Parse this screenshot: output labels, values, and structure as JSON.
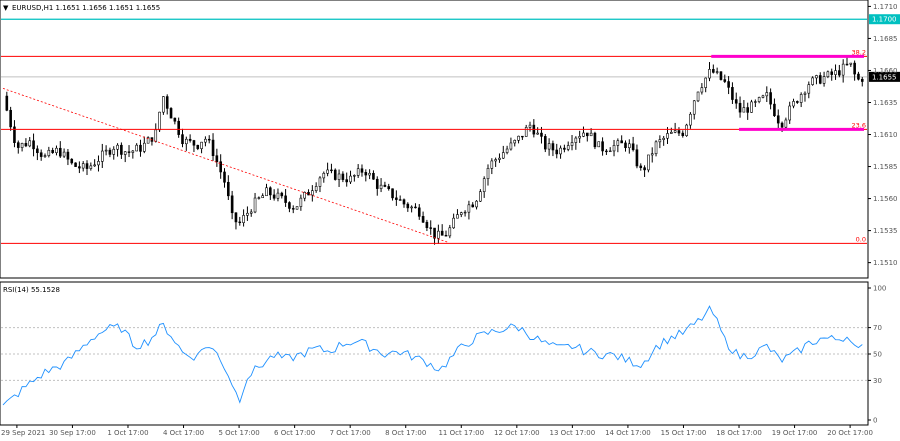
{
  "symbol_header": {
    "arrow": "▼",
    "text": "EURUSD,H1  1.1651 1.1656 1.1651 1.1655"
  },
  "indicator_header": "RSI(14) 55.1528",
  "colors": {
    "background": "#ffffff",
    "frame": "#000000",
    "candle": "#000000",
    "fib_line": "#ff0000",
    "resistance_line": "#00c0c0",
    "magenta_marker": "#ff00cc",
    "trendline": "#ff0000",
    "rsi_line": "#1e90ff",
    "rsi_level": "#c0c0c0",
    "bid_line": "#c0c0c0",
    "price_label_bg": "#000000",
    "price_label_text": "#ffffff"
  },
  "chart_data": [
    {
      "type": "candlestick",
      "symbol": "EURUSD",
      "timeframe": "H1",
      "ohlc_last": {
        "open": 1.1651,
        "high": 1.1656,
        "low": 1.1651,
        "close": 1.1655
      },
      "current_price": 1.1655,
      "ylim": [
        1.1498,
        1.1715
      ],
      "y_ticks": [
        "1.1710",
        "1.1685",
        "1.1660",
        "1.1635",
        "1.1610",
        "1.1585",
        "1.1560",
        "1.1535",
        "1.1510"
      ],
      "x_ticks": [
        "29 Sep 2021",
        "30 Sep 17:00",
        "1 Oct 17:00",
        "4 Oct 17:00",
        "5 Oct 17:00",
        "6 Oct 17:00",
        "7 Oct 17:00",
        "8 Oct 17:00",
        "11 Oct 17:00",
        "12 Oct 17:00",
        "13 Oct 17:00",
        "14 Oct 17:00",
        "15 Oct 17:00",
        "18 Oct 17:00",
        "19 Oct 17:00",
        "20 Oct 17:00"
      ],
      "close_path": [
        [
          0,
          1.164
        ],
        [
          2,
          1.16
        ],
        [
          4,
          1.1605
        ],
        [
          6,
          1.1592
        ],
        [
          8,
          1.1598
        ],
        [
          10,
          1.1586
        ],
        [
          12,
          1.1583
        ],
        [
          14,
          1.1592
        ],
        [
          16,
          1.1601
        ],
        [
          18,
          1.1596
        ],
        [
          20,
          1.16
        ],
        [
          22,
          1.1611
        ],
        [
          23,
          1.1641
        ],
        [
          24,
          1.1628
        ],
        [
          26,
          1.1605
        ],
        [
          28,
          1.1602
        ],
        [
          29,
          1.1608
        ],
        [
          30,
          1.16
        ],
        [
          32,
          1.1572
        ],
        [
          33,
          1.1545
        ],
        [
          34,
          1.154
        ],
        [
          36,
          1.1555
        ],
        [
          38,
          1.1565
        ],
        [
          40,
          1.156
        ],
        [
          42,
          1.1553
        ],
        [
          44,
          1.1565
        ],
        [
          46,
          1.158
        ],
        [
          48,
          1.1578
        ],
        [
          50,
          1.1575
        ],
        [
          52,
          1.1583
        ],
        [
          54,
          1.157
        ],
        [
          56,
          1.1563
        ],
        [
          58,
          1.1555
        ],
        [
          60,
          1.155
        ],
        [
          62,
          1.1532
        ],
        [
          63,
          1.153
        ],
        [
          64,
          1.1533
        ],
        [
          66,
          1.1551
        ],
        [
          68,
          1.1558
        ],
        [
          70,
          1.1586
        ],
        [
          72,
          1.1596
        ],
        [
          74,
          1.1605
        ],
        [
          76,
          1.1618
        ],
        [
          78,
          1.1601
        ],
        [
          80,
          1.1597
        ],
        [
          82,
          1.1608
        ],
        [
          84,
          1.1613
        ],
        [
          86,
          1.1599
        ],
        [
          88,
          1.1601
        ],
        [
          90,
          1.1603
        ],
        [
          92,
          1.158
        ],
        [
          94,
          1.1602
        ],
        [
          96,
          1.161
        ],
        [
          98,
          1.1612
        ],
        [
          100,
          1.1645
        ],
        [
          102,
          1.166
        ],
        [
          104,
          1.165
        ],
        [
          106,
          1.1628
        ],
        [
          108,
          1.1632
        ],
        [
          110,
          1.164
        ],
        [
          112,
          1.1618
        ],
        [
          114,
          1.1635
        ],
        [
          116,
          1.165
        ],
        [
          118,
          1.1654
        ],
        [
          120,
          1.1658
        ],
        [
          122,
          1.1665
        ],
        [
          123,
          1.1652
        ],
        [
          124,
          1.1655
        ]
      ],
      "fib_levels": [
        {
          "label": "38.2",
          "price": 1.1671
        },
        {
          "label": "23.6",
          "price": 1.1614
        },
        {
          "label": "0.0",
          "price": 1.1525
        }
      ],
      "resistance_level": {
        "label": "1.1700",
        "price": 1.17
      },
      "current_price_label": "1.1655",
      "magenta_segments": [
        {
          "x0": 102,
          "x1": 124,
          "price": 1.1671
        },
        {
          "x0": 106,
          "x1": 124,
          "price": 1.1614
        }
      ],
      "trendline": {
        "x0": 0,
        "y0": 1.1646,
        "x1": 64,
        "y1": 1.1526
      }
    },
    {
      "type": "line",
      "name": "RSI(14)",
      "value": 55.1528,
      "ylim": [
        0,
        100
      ],
      "y_ticks": [
        "100",
        "70",
        "50",
        "30",
        "0"
      ],
      "levels": [
        70,
        50,
        30
      ],
      "values": [
        [
          0,
          10
        ],
        [
          3,
          24
        ],
        [
          6,
          36
        ],
        [
          9,
          43
        ],
        [
          11,
          53
        ],
        [
          13,
          63
        ],
        [
          15,
          69
        ],
        [
          17,
          70
        ],
        [
          19,
          56
        ],
        [
          21,
          60
        ],
        [
          23,
          72
        ],
        [
          24,
          66
        ],
        [
          26,
          50
        ],
        [
          28,
          48
        ],
        [
          29,
          57
        ],
        [
          31,
          50
        ],
        [
          33,
          28
        ],
        [
          34,
          14
        ],
        [
          35,
          32
        ],
        [
          37,
          41
        ],
        [
          39,
          49
        ],
        [
          41,
          46
        ],
        [
          43,
          50
        ],
        [
          45,
          54
        ],
        [
          47,
          52
        ],
        [
          49,
          58
        ],
        [
          51,
          60
        ],
        [
          53,
          55
        ],
        [
          55,
          50
        ],
        [
          57,
          52
        ],
        [
          59,
          48
        ],
        [
          61,
          44
        ],
        [
          63,
          38
        ],
        [
          64,
          44
        ],
        [
          66,
          55
        ],
        [
          68,
          62
        ],
        [
          70,
          66
        ],
        [
          72,
          69
        ],
        [
          74,
          71
        ],
        [
          76,
          64
        ],
        [
          78,
          58
        ],
        [
          80,
          54
        ],
        [
          82,
          56
        ],
        [
          84,
          52
        ],
        [
          86,
          50
        ],
        [
          88,
          49
        ],
        [
          90,
          45
        ],
        [
          92,
          42
        ],
        [
          94,
          55
        ],
        [
          96,
          62
        ],
        [
          98,
          66
        ],
        [
          100,
          74
        ],
        [
          102,
          84
        ],
        [
          104,
          60
        ],
        [
          106,
          48
        ],
        [
          108,
          50
        ],
        [
          110,
          56
        ],
        [
          112,
          45
        ],
        [
          114,
          50
        ],
        [
          116,
          58
        ],
        [
          118,
          62
        ],
        [
          120,
          61
        ],
        [
          122,
          64
        ],
        [
          123,
          52
        ],
        [
          124,
          55.15
        ]
      ]
    }
  ]
}
